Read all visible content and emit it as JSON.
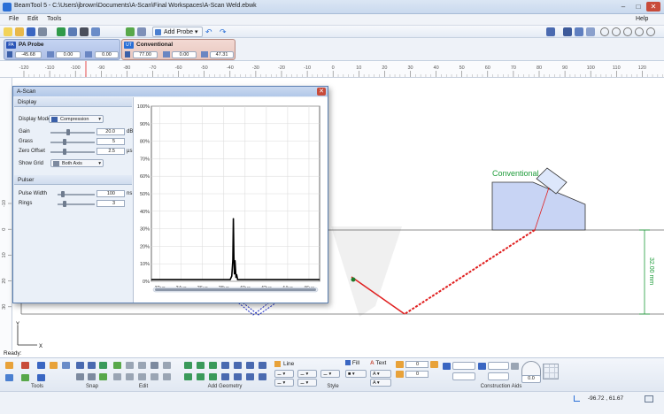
{
  "window": {
    "title": "BeamTool 5 - C:\\Users\\jbrown\\Documents\\A-Scan\\Final Workspaces\\A-Scan Weld.ebwk"
  },
  "menu": {
    "file": "File",
    "edit": "Edit",
    "tools": "Tools",
    "help": "Help"
  },
  "toolbar": {
    "add_probe_label": "Add Probe"
  },
  "probes": [
    {
      "badge": "PA",
      "name": "PA Probe",
      "values": [
        "-45.68",
        "0.00",
        "0.00"
      ]
    },
    {
      "badge": "UT",
      "name": "Conventional",
      "values": [
        "77.00",
        "0.00",
        "47.31"
      ]
    }
  ],
  "ruler": {
    "h_ticks": [
      "-120",
      "-110",
      "-100",
      "-90",
      "-80",
      "-70",
      "-60",
      "-50",
      "-40",
      "-30",
      "-20",
      "-10",
      "0",
      "10",
      "20",
      "30",
      "40",
      "50",
      "60",
      "70",
      "80",
      "90",
      "100",
      "110",
      "120"
    ],
    "v_ticks": [
      "-10",
      "0",
      "10",
      "20",
      "30"
    ]
  },
  "canvas": {
    "conventional_label": "Conventional",
    "thickness_label": "32.00 mm",
    "axis_y": "Y",
    "axis_x": "X"
  },
  "ascan": {
    "title": "A-Scan",
    "display_section": "Display",
    "display_mode_label": "Display Mode",
    "display_mode_value": "Compression",
    "gain_label": "Gain",
    "gain_value": "20.0",
    "gain_unit": "dB",
    "gain_level": 0.4,
    "grass_label": "Grass",
    "grass_value": "5",
    "grass_level": 0.3,
    "zero_offset_label": "Zero Offset",
    "zero_offset_value": "2.5",
    "zero_offset_unit": "µs",
    "zero_offset_level": 0.3,
    "show_grid_label": "Show Grid",
    "show_grid_value": "Both Axis",
    "pulser_section": "Pulser",
    "pulse_width_label": "Pulse Width",
    "pulse_width_value": "100",
    "pulse_width_unit": "ns",
    "pulse_width_level": 0.1,
    "rings_label": "Rings",
    "rings_value": "3",
    "rings_level": 0.15
  },
  "chart_data": {
    "type": "line",
    "xlabel": "",
    "ylabel": "",
    "xlim": [
      31.2,
      47.0
    ],
    "ylim": [
      0,
      100
    ],
    "x_ticks": [
      "32µs",
      "34µs",
      "36µs",
      "38µs",
      "40µs",
      "42µs",
      "44µs",
      "46µs"
    ],
    "y_ticks": [
      "0%",
      "10%",
      "20%",
      "30%",
      "40%",
      "50%",
      "60%",
      "70%",
      "80%",
      "90%",
      "100%"
    ],
    "grid": true,
    "series": [
      {
        "x": [
          31.2,
          38.6,
          38.75,
          38.85,
          38.9,
          38.95,
          39.0,
          39.05,
          39.1,
          39.15,
          39.2,
          39.3,
          47.0
        ],
        "values": [
          1,
          1,
          3,
          12,
          36,
          14,
          4,
          12,
          7,
          2,
          4,
          1,
          1
        ]
      }
    ],
    "color": "#000000"
  },
  "ribbon": {
    "tools_label": "Tools",
    "snap_label": "Snap",
    "edit_label": "Edit",
    "add_geometry_label": "Add Geometry",
    "style_label": "Style",
    "line_label": "Line",
    "fill_label": "Fill",
    "text_label": "Text",
    "style_value_1": "0",
    "style_value_2": "0",
    "construction_aids_label": "Construction Aids",
    "angle_value": "0.0"
  },
  "status": {
    "ready": "Ready",
    "coords": "-96.72 , 61.67"
  },
  "colors": {
    "accent": "#2a6fd6",
    "beam_red": "#e02020",
    "wedge_fill": "#c8d4f4",
    "dimension_green": "#1e9c3a",
    "phased_array_blue": "#2233cc"
  }
}
